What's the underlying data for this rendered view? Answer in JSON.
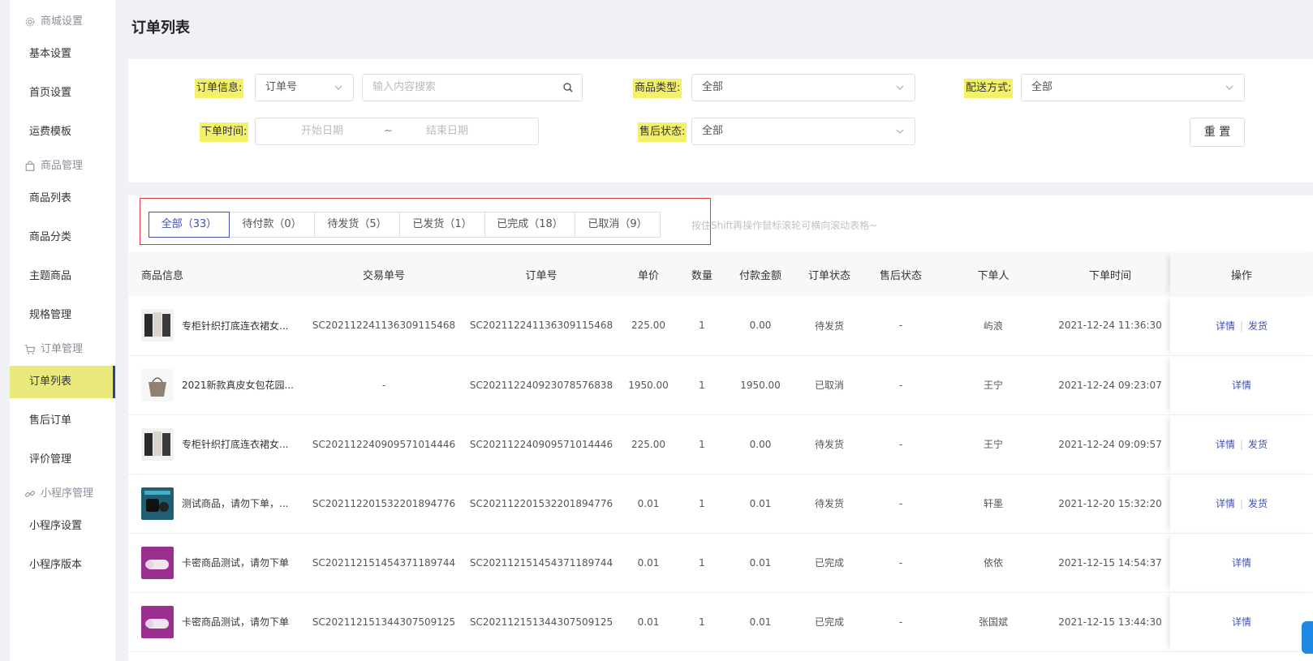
{
  "sidebar": {
    "groups": [
      {
        "label": "商城设置",
        "icon": "gear-icon",
        "items": [
          "基本设置",
          "首页设置",
          "运费模板"
        ]
      },
      {
        "label": "商品管理",
        "icon": "bag-icon",
        "items": [
          "商品列表",
          "商品分类",
          "主题商品",
          "规格管理"
        ]
      },
      {
        "label": "订单管理",
        "icon": "cart-icon",
        "items": [
          "订单列表",
          "售后订单",
          "评价管理"
        ]
      },
      {
        "label": "小程序管理",
        "icon": "link-icon",
        "items": [
          "小程序设置",
          "小程序版本"
        ]
      }
    ],
    "active": "订单列表"
  },
  "page_title": "订单列表",
  "filters": {
    "order_info_label": "订单信息:",
    "order_info_select": "订单号",
    "search_placeholder": "输入内容搜索",
    "goods_type_label": "商品类型:",
    "goods_type_value": "全部",
    "delivery_label": "配送方式:",
    "delivery_value": "全部",
    "order_time_label": "下单时间:",
    "start_placeholder": "开始日期",
    "range_sep": "~",
    "end_placeholder": "结束日期",
    "after_sale_label": "售后状态:",
    "after_sale_value": "全部",
    "reset_label": "重 置"
  },
  "tabs": [
    {
      "label": "全部（33）",
      "active": true
    },
    {
      "label": "待付款（0）",
      "active": false
    },
    {
      "label": "待发货（5）",
      "active": false
    },
    {
      "label": "已发货（1）",
      "active": false
    },
    {
      "label": "已完成（18）",
      "active": false
    },
    {
      "label": "已取消（9）",
      "active": false
    }
  ],
  "hint": "按住Shift再操作鼠标滚轮可横向滚动表格~",
  "table": {
    "headers": [
      "商品信息",
      "交易单号",
      "订单号",
      "单价",
      "数量",
      "付款金额",
      "订单状态",
      "售后状态",
      "下单人",
      "下单时间",
      "操作"
    ],
    "rows": [
      {
        "thumb": "clothes",
        "name": "专柜针织打底连衣裙女...",
        "trade_no": "SC202112241136309115468",
        "order_no": "SC202112241136309115468",
        "price": "225.00",
        "qty": "1",
        "paid": "0.00",
        "status": "待发货",
        "after_sale": "-",
        "buyer": "屿浪",
        "time": "2021-12-24 11:36:30",
        "ops": [
          "详情",
          "发货"
        ]
      },
      {
        "thumb": "bag",
        "name": "2021新款真皮女包花园...",
        "trade_no": "-",
        "order_no": "SC202112240923078576838",
        "price": "1950.00",
        "qty": "1",
        "paid": "1950.00",
        "status": "已取消",
        "after_sale": "-",
        "buyer": "王宁",
        "time": "2021-12-24 09:23:07",
        "ops": [
          "详情"
        ]
      },
      {
        "thumb": "clothes",
        "name": "专柜针织打底连衣裙女...",
        "trade_no": "SC202112240909571014446",
        "order_no": "SC202112240909571014446",
        "price": "225.00",
        "qty": "1",
        "paid": "0.00",
        "status": "待发货",
        "after_sale": "-",
        "buyer": "王宁",
        "time": "2021-12-24 09:09:57",
        "ops": [
          "详情",
          "发货"
        ]
      },
      {
        "thumb": "device",
        "name": "测试商品，请勿下单，...",
        "trade_no": "SC202112201532201894776",
        "order_no": "SC202112201532201894776",
        "price": "0.01",
        "qty": "1",
        "paid": "0.01",
        "status": "待发货",
        "after_sale": "-",
        "buyer": "轩墨",
        "time": "2021-12-20 15:32:20",
        "ops": [
          "详情",
          "发货"
        ]
      },
      {
        "thumb": "card",
        "name": "卡密商品测试，请勿下单",
        "trade_no": "SC202112151454371189744",
        "order_no": "SC202112151454371189744",
        "price": "0.01",
        "qty": "1",
        "paid": "0.01",
        "status": "已完成",
        "after_sale": "-",
        "buyer": "依依",
        "time": "2021-12-15 14:54:37",
        "ops": [
          "详情"
        ]
      },
      {
        "thumb": "card",
        "name": "卡密商品测试，请勿下单",
        "trade_no": "SC202112151344307509125",
        "order_no": "SC202112151344307509125",
        "price": "0.01",
        "qty": "1",
        "paid": "0.01",
        "status": "已完成",
        "after_sale": "-",
        "buyer": "张国斌",
        "time": "2021-12-15 13:44:30",
        "ops": [
          "详情"
        ]
      }
    ]
  },
  "colors": {
    "accent": "#3f51b5",
    "highlight": "#f3f06a",
    "active_menu": "#e8e97a",
    "outline": "#e43c3c"
  }
}
